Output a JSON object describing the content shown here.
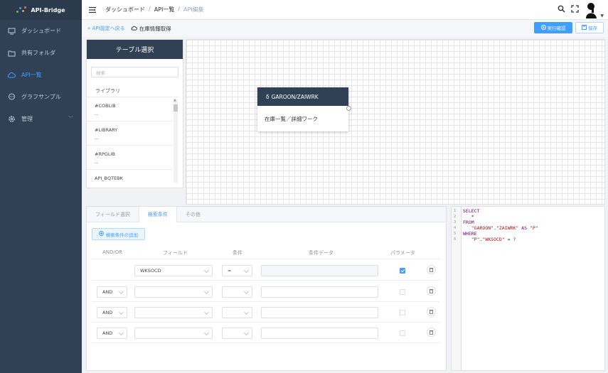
{
  "brand": {
    "name": "API-Bridge",
    "dot_colors": [
      "#67c23a",
      "#409eff",
      "#e6a23c",
      "#f56c6c"
    ]
  },
  "sidebar": {
    "items": [
      {
        "label": "ダッシュボード",
        "icon": "monitor-icon",
        "active": false
      },
      {
        "label": "共有フォルダ",
        "icon": "folder-icon",
        "active": false
      },
      {
        "label": "API一覧",
        "icon": "cloud-icon",
        "active": true
      },
      {
        "label": "グラフサンプル",
        "icon": "chat-icon",
        "active": false
      },
      {
        "label": "管理",
        "icon": "gear-icon",
        "active": false,
        "chevron": "﹀"
      }
    ]
  },
  "header": {
    "breadcrumb": [
      "ダッシュボード",
      "API一覧",
      "API編集"
    ]
  },
  "subbar": {
    "back_label": "« API設定へ戻る",
    "page_title": "在庫情報取得",
    "run_label": "実行確認",
    "save_label": "保存"
  },
  "table_panel": {
    "title": "テーブル選択",
    "search_placeholder": "検索",
    "library_label": "ライブラリ",
    "items": [
      {
        "name": "#COBLIB",
        "sub": "--"
      },
      {
        "name": "#LIBRARY",
        "sub": "--"
      },
      {
        "name": "#RPGLIB",
        "sub": "--"
      },
      {
        "name": "API_BQTEBK",
        "sub": ""
      }
    ]
  },
  "canvas": {
    "node": {
      "title": "GAROON/ZAIWRK",
      "body": "在庫一覧／詳細ワーク"
    }
  },
  "bottom": {
    "tabs": [
      {
        "label": "フィールド選択",
        "active": false
      },
      {
        "label": "検索条件",
        "active": true
      },
      {
        "label": "その他",
        "active": false
      }
    ],
    "add_condition_label": "検索条件の追加",
    "columns": {
      "andor": "AND/OR",
      "field": "フィールド",
      "cond": "条件",
      "data": "条件データ",
      "param": "パラメータ"
    },
    "rows": [
      {
        "andor": "",
        "field": "WKSOCD",
        "cond": "=",
        "checked": true
      },
      {
        "andor": "AND",
        "field": "",
        "cond": "",
        "checked": false
      },
      {
        "andor": "AND",
        "field": "",
        "cond": "",
        "checked": false
      },
      {
        "andor": "AND",
        "field": "",
        "cond": "",
        "checked": false
      }
    ]
  },
  "sql": {
    "lines": [
      "1",
      "2",
      "3",
      "4",
      "5",
      "6"
    ]
  }
}
